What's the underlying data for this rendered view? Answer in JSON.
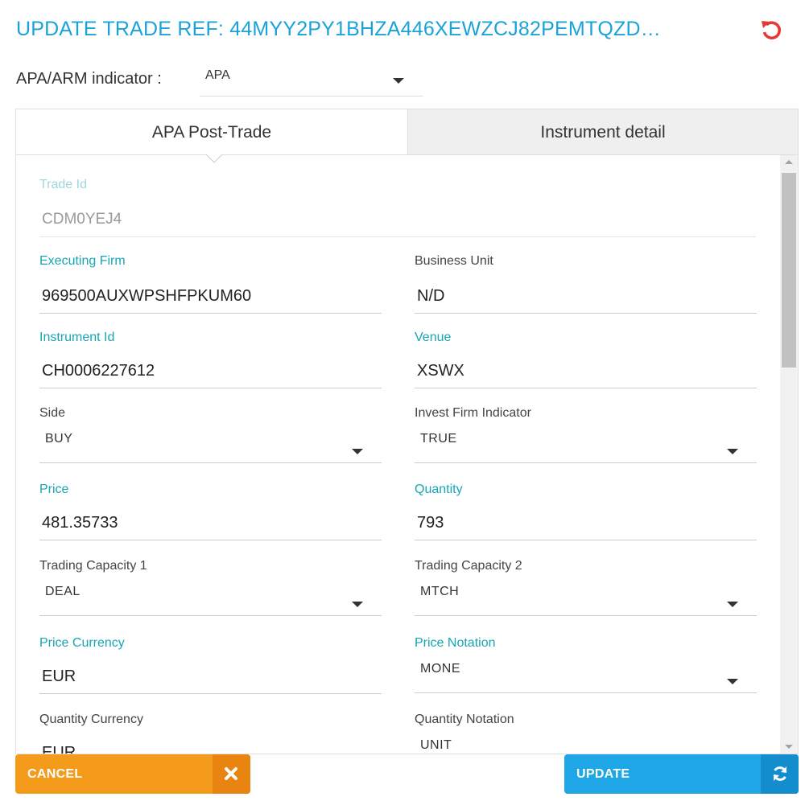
{
  "header": {
    "title": "UPDATE TRADE REF: 44MYY2PY1BHZA446XEWZCJ82PEMTQZD…",
    "reset_icon": "undo-icon",
    "accent_color": "#1aa3d9",
    "reset_color": "#e53935"
  },
  "apa_indicator": {
    "label": "APA/ARM indicator :",
    "value": "APA"
  },
  "tabs": [
    {
      "label": "APA Post-Trade",
      "active": true
    },
    {
      "label": "Instrument detail",
      "active": false
    }
  ],
  "fields": {
    "trade_id": {
      "label": "Trade Id",
      "value": "CDM0YEJ4"
    },
    "executing_firm": {
      "label": "Executing Firm",
      "value": "969500AUXWPSHFPKUM60"
    },
    "business_unit": {
      "label": "Business Unit",
      "value": "N/D"
    },
    "instrument_id": {
      "label": "Instrument Id",
      "value": "CH0006227612"
    },
    "venue": {
      "label": "Venue",
      "value": "XSWX"
    },
    "side": {
      "label": "Side",
      "value": "BUY"
    },
    "invest_firm_indicator": {
      "label": "Invest Firm Indicator",
      "value": "TRUE"
    },
    "price": {
      "label": "Price",
      "value": "481.35733"
    },
    "quantity": {
      "label": "Quantity",
      "value": "793"
    },
    "trading_capacity_1": {
      "label": "Trading Capacity 1",
      "value": "DEAL"
    },
    "trading_capacity_2": {
      "label": "Trading Capacity 2",
      "value": "MTCH"
    },
    "price_currency": {
      "label": "Price Currency",
      "value": "EUR"
    },
    "price_notation": {
      "label": "Price Notation",
      "value": "MONE"
    },
    "quantity_currency": {
      "label": "Quantity Currency",
      "value": "EUR"
    },
    "quantity_notation": {
      "label": "Quantity Notation",
      "value": "UNIT"
    }
  },
  "buttons": {
    "cancel": {
      "label": "CANCEL",
      "icon": "close-icon",
      "color": "#f59b1c"
    },
    "update": {
      "label": "UPDATE",
      "icon": "refresh-icon",
      "color": "#1ea6e6"
    }
  }
}
